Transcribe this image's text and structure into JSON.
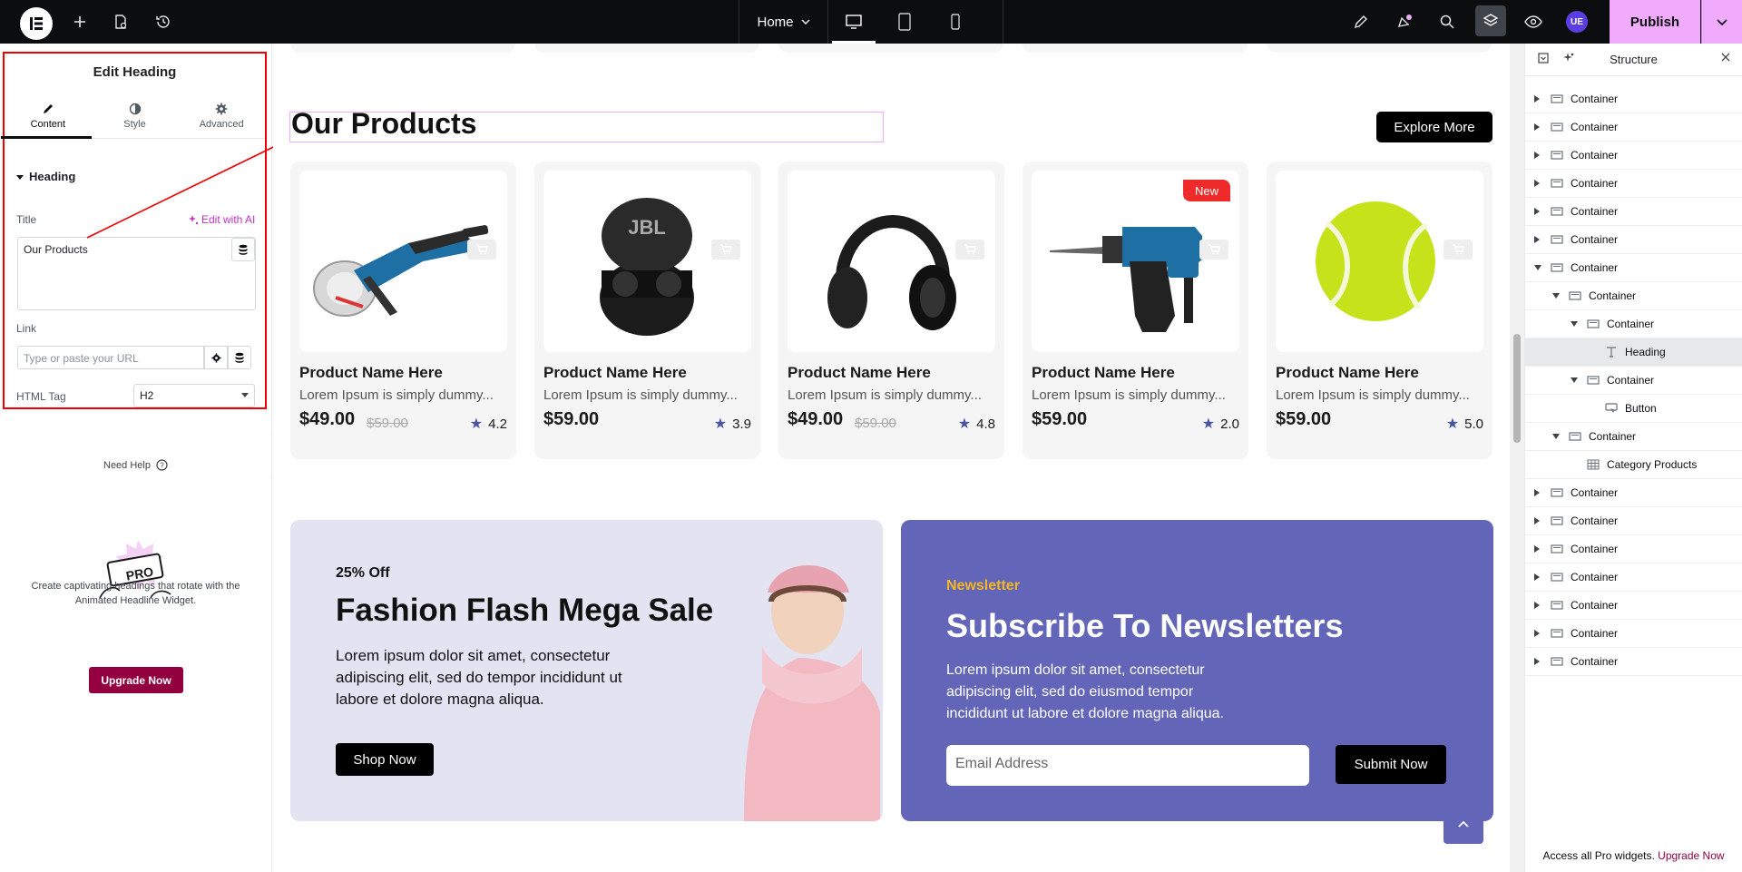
{
  "topbar": {
    "page_label": "Home",
    "publish_label": "Publish",
    "avatar_initials": "UE",
    "accent": "#f0abfc"
  },
  "left_panel": {
    "title": "Edit Heading",
    "tabs": [
      {
        "label": "Content",
        "icon": "pencil-icon",
        "active": true
      },
      {
        "label": "Style",
        "icon": "half-circle-icon",
        "active": false
      },
      {
        "label": "Advanced",
        "icon": "gear-icon",
        "active": false
      }
    ],
    "section": "Heading",
    "title_label": "Title",
    "ai_label": "Edit with AI",
    "title_value": "Our Products",
    "link_label": "Link",
    "link_placeholder": "Type or paste your URL",
    "html_tag_label": "HTML Tag",
    "html_tag_value": "H2",
    "need_help": "Need Help",
    "promo_text": "Create captivating headings that rotate with the Animated Headline Widget.",
    "promo_badge": "PRO",
    "upgrade_label": "Upgrade Now"
  },
  "canvas": {
    "heading": "Our Products",
    "explore_label": "Explore More",
    "products": [
      {
        "name": "Product Name Here",
        "desc": "Lorem Ipsum is simply dummy...",
        "price": "$49.00",
        "old_price": "$59.00",
        "rating": "4.2",
        "badge": "",
        "image": "angle-grinder"
      },
      {
        "name": "Product Name Here",
        "desc": "Lorem Ipsum is simply dummy...",
        "price": "$59.00",
        "old_price": "",
        "rating": "3.9",
        "badge": "",
        "image": "earbuds"
      },
      {
        "name": "Product Name Here",
        "desc": "Lorem Ipsum is simply dummy...",
        "price": "$49.00",
        "old_price": "$59.00",
        "rating": "4.8",
        "badge": "",
        "image": "headphones"
      },
      {
        "name": "Product Name Here",
        "desc": "Lorem Ipsum is simply dummy...",
        "price": "$59.00",
        "old_price": "",
        "rating": "2.0",
        "badge": "New",
        "image": "drill"
      },
      {
        "name": "Product Name Here",
        "desc": "Lorem Ipsum is simply dummy...",
        "price": "$59.00",
        "old_price": "",
        "rating": "5.0",
        "badge": "",
        "image": "tennis-ball"
      }
    ],
    "sale": {
      "off": "25% Off",
      "title": "Fashion Flash Mega Sale",
      "text": "Lorem ipsum dolor sit amet, consectetur adipiscing elit, sed do tempor incididunt ut labore et dolore magna aliqua.",
      "button": "Shop Now"
    },
    "newsletter": {
      "label": "Newsletter",
      "title": "Subscribe To Newsletters",
      "text": "Lorem ipsum dolor sit amet, consectetur adipiscing elit, sed do eiusmod tempor incididunt ut labore et dolore magna aliqua.",
      "placeholder": "Email Address",
      "button": "Submit Now"
    }
  },
  "structure": {
    "title": "Structure",
    "rows": [
      {
        "label": "Container",
        "depth": 0,
        "caret": "right",
        "icon": "container-icon"
      },
      {
        "label": "Container",
        "depth": 0,
        "caret": "right",
        "icon": "container-icon"
      },
      {
        "label": "Container",
        "depth": 0,
        "caret": "right",
        "icon": "container-icon"
      },
      {
        "label": "Container",
        "depth": 0,
        "caret": "right",
        "icon": "container-icon"
      },
      {
        "label": "Container",
        "depth": 0,
        "caret": "right",
        "icon": "container-icon"
      },
      {
        "label": "Container",
        "depth": 0,
        "caret": "right",
        "icon": "container-icon"
      },
      {
        "label": "Container",
        "depth": 0,
        "caret": "down",
        "icon": "container-icon"
      },
      {
        "label": "Container",
        "depth": 1,
        "caret": "down",
        "icon": "container-icon"
      },
      {
        "label": "Container",
        "depth": 2,
        "caret": "down",
        "icon": "container-icon"
      },
      {
        "label": "Heading",
        "depth": 3,
        "caret": "",
        "icon": "heading-icon",
        "selected": true
      },
      {
        "label": "Container",
        "depth": 2,
        "caret": "down",
        "icon": "container-icon"
      },
      {
        "label": "Button",
        "depth": 3,
        "caret": "",
        "icon": "button-icon"
      },
      {
        "label": "Container",
        "depth": 1,
        "caret": "down",
        "icon": "container-icon"
      },
      {
        "label": "Category Products",
        "depth": 2,
        "caret": "",
        "icon": "grid-icon"
      },
      {
        "label": "Container",
        "depth": 0,
        "caret": "right",
        "icon": "container-icon"
      },
      {
        "label": "Container",
        "depth": 0,
        "caret": "right",
        "icon": "container-icon"
      },
      {
        "label": "Container",
        "depth": 0,
        "caret": "right",
        "icon": "container-icon"
      },
      {
        "label": "Container",
        "depth": 0,
        "caret": "right",
        "icon": "container-icon"
      },
      {
        "label": "Container",
        "depth": 0,
        "caret": "right",
        "icon": "container-icon"
      },
      {
        "label": "Container",
        "depth": 0,
        "caret": "right",
        "icon": "container-icon"
      },
      {
        "label": "Container",
        "depth": 0,
        "caret": "right",
        "icon": "container-icon"
      }
    ],
    "footer_text": "Access all Pro widgets.",
    "footer_link": "Upgrade Now"
  }
}
